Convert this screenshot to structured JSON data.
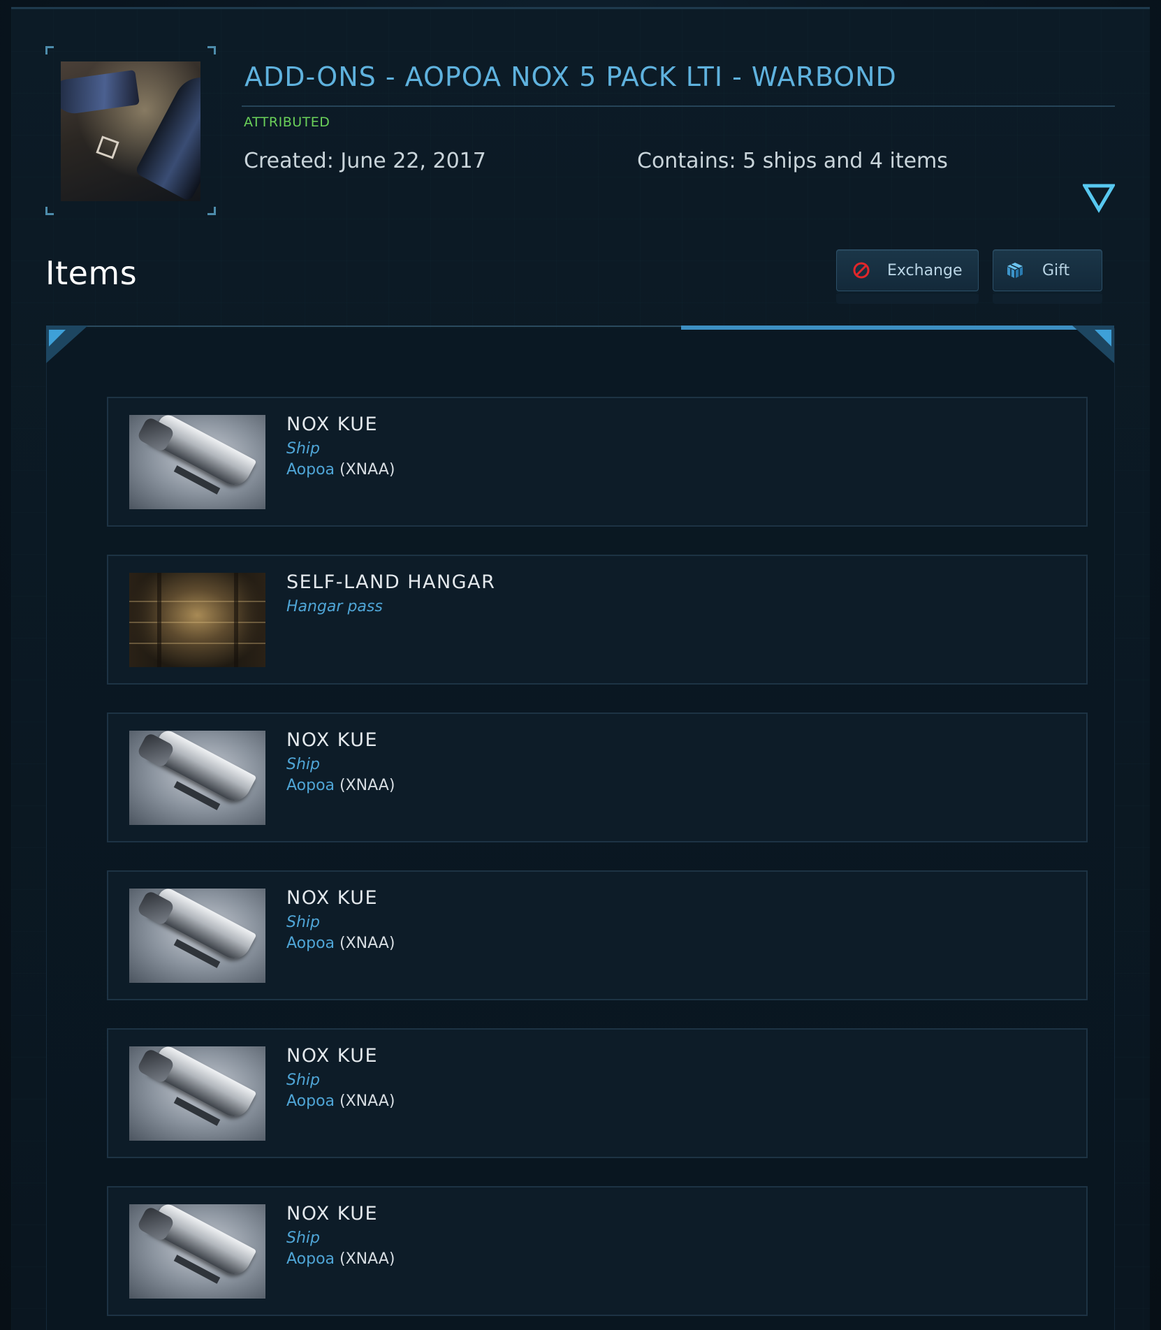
{
  "pledge": {
    "title": "ADD-ONS - AOPOA NOX 5 PACK LTI - WARBOND",
    "status": "ATTRIBUTED",
    "created": "Created: June 22, 2017",
    "contains": "Contains: 5 ships and 4 items",
    "accent_color": "#5fb2de",
    "status_color": "#6bd15a"
  },
  "items_section": {
    "heading": "Items",
    "exchange_label": "Exchange",
    "gift_label": "Gift",
    "exchange_icon": "prohibited-icon",
    "gift_icon": "gift-cube-icon"
  },
  "items": [
    {
      "name": "NOX KUE",
      "kind": "Ship",
      "maker": "Aopoa",
      "code": "(XNAA)",
      "image": "nox-kue-ship"
    },
    {
      "name": "SELF-LAND HANGAR",
      "kind": "Hangar pass",
      "maker": "",
      "code": "",
      "image": "hangar-interior"
    },
    {
      "name": "NOX KUE",
      "kind": "Ship",
      "maker": "Aopoa",
      "code": "(XNAA)",
      "image": "nox-kue-ship"
    },
    {
      "name": "NOX KUE",
      "kind": "Ship",
      "maker": "Aopoa",
      "code": "(XNAA)",
      "image": "nox-kue-ship"
    },
    {
      "name": "NOX KUE",
      "kind": "Ship",
      "maker": "Aopoa",
      "code": "(XNAA)",
      "image": "nox-kue-ship"
    },
    {
      "name": "NOX KUE",
      "kind": "Ship",
      "maker": "Aopoa",
      "code": "(XNAA)",
      "image": "nox-kue-ship"
    }
  ]
}
